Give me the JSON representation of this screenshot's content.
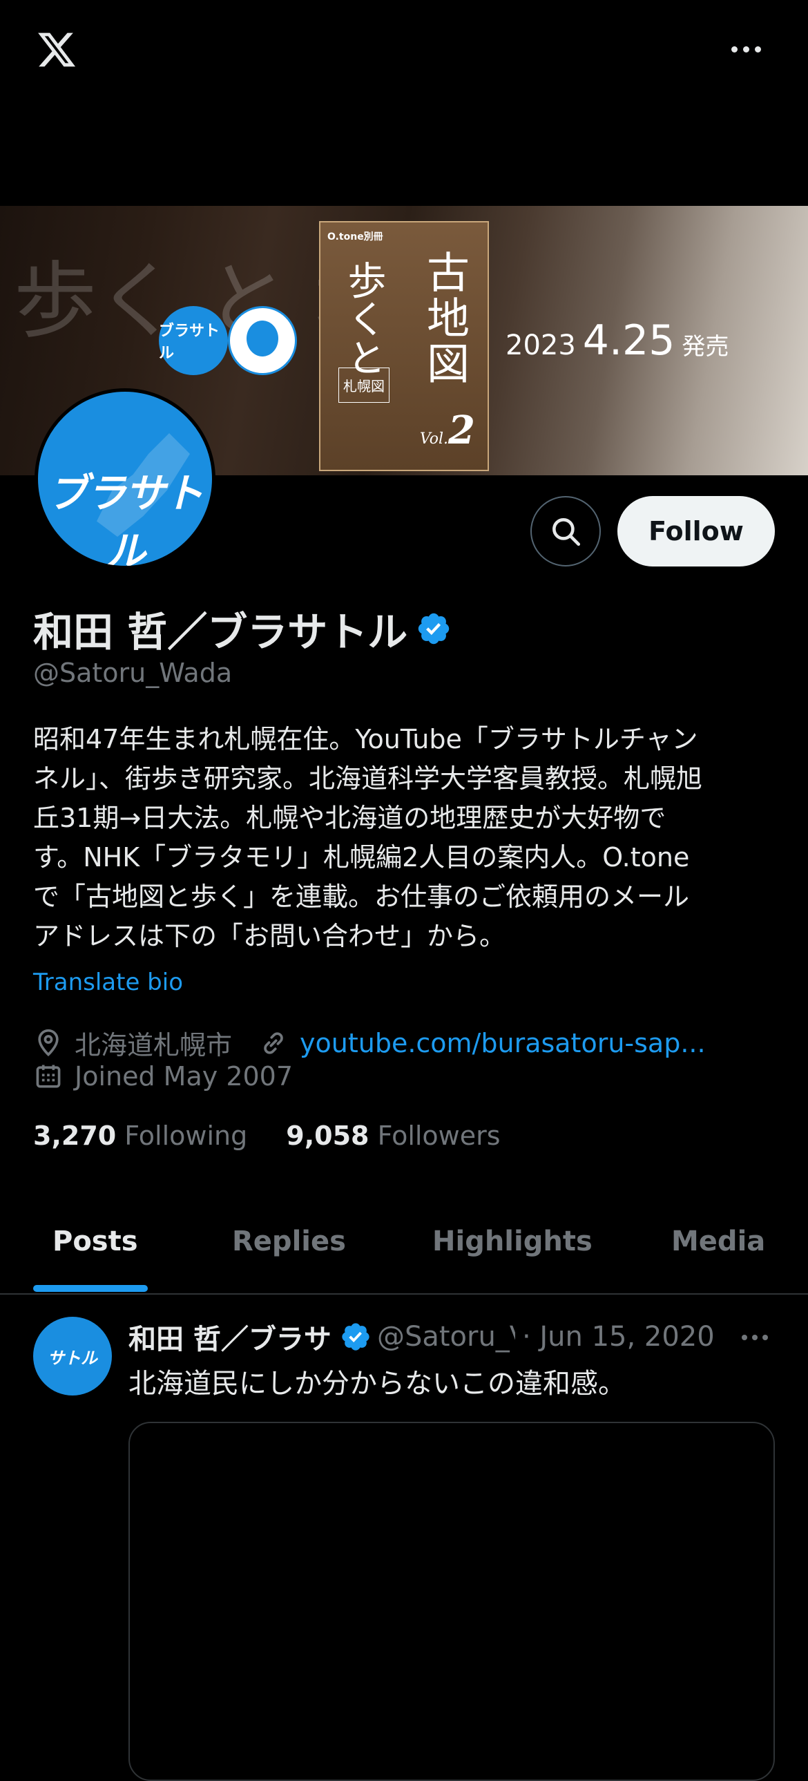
{
  "banner": {
    "ghost_text": "歩く と 地",
    "logo_badge_text": "ブラサトル",
    "book": {
      "publisher": "O.tone別冊",
      "title_right": "古地図",
      "title_left": "歩くと",
      "subtitle": "札幌図",
      "vol_label": "Vol.",
      "vol_number": "2"
    },
    "date_year": "2023",
    "date_md": "4.25",
    "date_suffix": "発売"
  },
  "avatar": {
    "text": "ブラサトル"
  },
  "actions": {
    "follow_label": "Follow"
  },
  "profile": {
    "name": "和田 哲／ブラサトル",
    "handle": "@Satoru_Wada",
    "bio": "昭和47年生まれ札幌在住。YouTube「ブラサトルチャン\nネル」、街歩き研究家。北海道科学大学客員教授。札幌旭\n丘31期→日大法。札幌や北海道の地理歴史が大好物で\nす。NHK「ブラタモリ」札幌編2人目の案内人。O.tone\nで「古地図と歩く」を連載。お仕事のご依頼用のメール\nアドレスは下の「お問い合わせ」から。",
    "translate_label": "Translate bio",
    "location": "北海道札幌市",
    "website": "youtube.com/burasatoru-sap...",
    "joined": "Joined May 2007",
    "following_count": "3,270",
    "following_label": "Following",
    "followers_count": "9,058",
    "followers_label": "Followers"
  },
  "tabs": [
    "Posts",
    "Replies",
    "Highlights",
    "Media"
  ],
  "post": {
    "avatar_text": "サトル",
    "author_name": "和田 哲／ブラサ",
    "author_handle": "@Satoru_V",
    "date": "· Jun 15, 2020",
    "text": "北海道民にしか分からないこの違和感。"
  },
  "colors": {
    "accent": "#1d9bf0",
    "background": "#000000",
    "muted": "#71767b",
    "brand_blue": "#1a8ee0"
  },
  "icons": [
    "x-logo-icon",
    "more-icon",
    "search-icon",
    "verified-icon",
    "location-icon",
    "link-icon",
    "calendar-icon"
  ]
}
